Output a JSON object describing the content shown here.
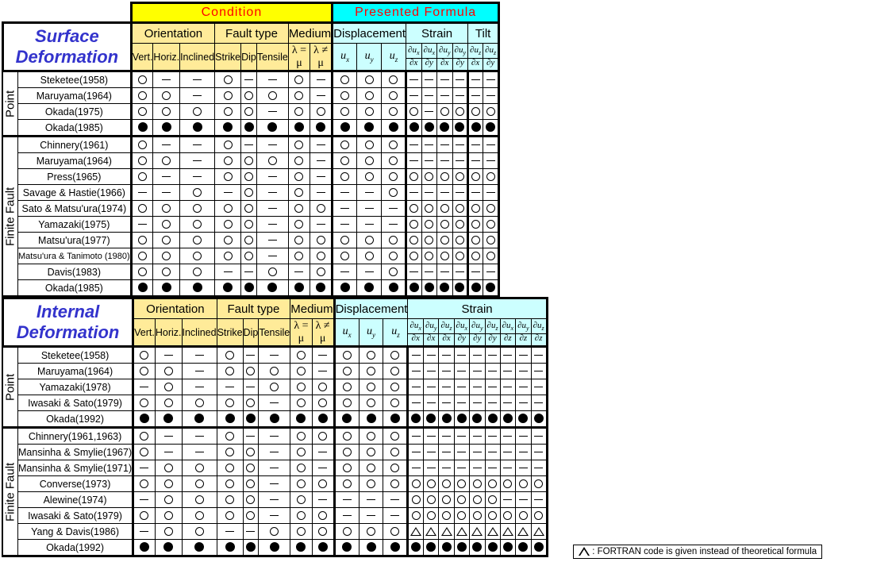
{
  "legend": {
    "triangle_note": ": FORTRAN code is given instead of theoretical formula",
    "symbols": {
      "open": "open-circle",
      "filled": "filled-circle",
      "dash": "dash",
      "triangle": "open-triangle"
    }
  },
  "colors": {
    "condition_band": "#ffff00",
    "presented_band": "#00ffff",
    "band_text": "#ff0000",
    "group_yellow": "#ffeb99",
    "group_cyan": "#ccffff",
    "title_green": "#ccf5cc",
    "title_text": "#3333cc"
  },
  "surface": {
    "title_line1": "Surface",
    "title_line2": "Deformation",
    "bands": {
      "condition": "Condition",
      "presented": "Presented Formula"
    },
    "groups": {
      "orientation": "Orientation",
      "fault_type": "Fault type",
      "medium": "Medium",
      "displacement": "Displacement",
      "strain": "Strain",
      "tilt": "Tilt"
    },
    "subheaders": {
      "orientation": [
        "Vert.",
        "Horiz.",
        "Inclined"
      ],
      "fault_type": [
        "Strike",
        "Dip",
        "Tensile"
      ],
      "medium": [
        "λ = μ",
        "λ ≠ μ"
      ],
      "displacement": [
        {
          "num": "u",
          "sub": "x"
        },
        {
          "num": "u",
          "sub": "y"
        },
        {
          "num": "u",
          "sub": "z"
        }
      ],
      "strain": [
        {
          "num": "∂u",
          "nsub": "x",
          "den": "∂x"
        },
        {
          "num": "∂u",
          "nsub": "x",
          "den": "∂y"
        },
        {
          "num": "∂u",
          "nsub": "y",
          "den": "∂x"
        },
        {
          "num": "∂u",
          "nsub": "y",
          "den": "∂y"
        }
      ],
      "tilt": [
        {
          "num": "∂u",
          "nsub": "z",
          "den": "∂x"
        },
        {
          "num": "∂u",
          "nsub": "z",
          "den": "∂y"
        }
      ]
    },
    "sections": [
      {
        "label": "Point",
        "rows": [
          {
            "name": "Steketee(1958)",
            "marks": [
              "o",
              "-",
              "-",
              "o",
              "-",
              "-",
              "o",
              "-",
              "o",
              "o",
              "o",
              "-",
              "-",
              "-",
              "-",
              "-",
              "-"
            ]
          },
          {
            "name": "Maruyama(1964)",
            "marks": [
              "o",
              "o",
              "-",
              "o",
              "o",
              "o",
              "o",
              "-",
              "o",
              "o",
              "o",
              "-",
              "-",
              "-",
              "-",
              "-",
              "-"
            ]
          },
          {
            "name": "Okada(1975)",
            "marks": [
              "o",
              "o",
              "o",
              "o",
              "o",
              "-",
              "o",
              "o",
              "o",
              "o",
              "o",
              "o",
              "-",
              "o",
              "o",
              "o",
              "o"
            ]
          },
          {
            "name": "Okada(1985)",
            "marks": [
              "f",
              "f",
              "f",
              "f",
              "f",
              "f",
              "f",
              "f",
              "f",
              "f",
              "f",
              "f",
              "f",
              "f",
              "f",
              "f",
              "f"
            ]
          }
        ]
      },
      {
        "label": "Finite Fault",
        "rows": [
          {
            "name": "Chinnery(1961)",
            "marks": [
              "o",
              "-",
              "-",
              "o",
              "-",
              "-",
              "o",
              "-",
              "o",
              "o",
              "o",
              "-",
              "-",
              "-",
              "-",
              "-",
              "-"
            ]
          },
          {
            "name": "Maruyama(1964)",
            "marks": [
              "o",
              "o",
              "-",
              "o",
              "o",
              "o",
              "o",
              "-",
              "o",
              "o",
              "o",
              "-",
              "-",
              "-",
              "-",
              "-",
              "-"
            ]
          },
          {
            "name": "Press(1965)",
            "marks": [
              "o",
              "-",
              "-",
              "o",
              "o",
              "-",
              "o",
              "-",
              "o",
              "o",
              "o",
              "o",
              "o",
              "o",
              "o",
              "o",
              "o"
            ]
          },
          {
            "name": "Savage & Hastie(1966)",
            "marks": [
              "-",
              "-",
              "o",
              "-",
              "o",
              "-",
              "o",
              "-",
              "-",
              "-",
              "o",
              "-",
              "-",
              "-",
              "-",
              "-",
              "-"
            ]
          },
          {
            "name": "Sato & Matsu'ura(1974)",
            "marks": [
              "o",
              "o",
              "o",
              "o",
              "o",
              "-",
              "o",
              "o",
              "-",
              "-",
              "-",
              "o",
              "o",
              "o",
              "o",
              "o",
              "o"
            ]
          },
          {
            "name": "Yamazaki(1975)",
            "marks": [
              "-",
              "o",
              "o",
              "o",
              "o",
              "-",
              "o",
              "-",
              "-",
              "-",
              "-",
              "o",
              "o",
              "o",
              "o",
              "o",
              "o"
            ]
          },
          {
            "name": "Matsu'ura(1977)",
            "marks": [
              "o",
              "o",
              "o",
              "o",
              "o",
              "-",
              "o",
              "o",
              "o",
              "o",
              "o",
              "o",
              "o",
              "o",
              "o",
              "o",
              "o"
            ]
          },
          {
            "name": "Matsu'ura & Tanimoto (1980)",
            "marks": [
              "o",
              "o",
              "o",
              "o",
              "o",
              "-",
              "o",
              "o",
              "o",
              "o",
              "o",
              "o",
              "o",
              "o",
              "o",
              "o",
              "o"
            ],
            "small": true
          },
          {
            "name": "Davis(1983)",
            "marks": [
              "o",
              "o",
              "o",
              "-",
              "-",
              "o",
              "-",
              "o",
              "-",
              "-",
              "o",
              "-",
              "-",
              "-",
              "-",
              "-",
              "-"
            ]
          },
          {
            "name": "Okada(1985)",
            "marks": [
              "f",
              "f",
              "f",
              "f",
              "f",
              "f",
              "f",
              "f",
              "f",
              "f",
              "f",
              "f",
              "f",
              "f",
              "f",
              "f",
              "f"
            ]
          }
        ]
      }
    ]
  },
  "internal": {
    "title_line1": "Internal",
    "title_line2": "Deformation",
    "groups": {
      "orientation": "Orientation",
      "fault_type": "Fault type",
      "medium": "Medium",
      "displacement": "Displacement",
      "strain": "Strain"
    },
    "subheaders": {
      "orientation": [
        "Vert.",
        "Horiz.",
        "Inclined"
      ],
      "fault_type": [
        "Strike",
        "Dip",
        "Tensile"
      ],
      "medium": [
        "λ = μ",
        "λ ≠ μ"
      ],
      "displacement": [
        {
          "num": "u",
          "sub": "x"
        },
        {
          "num": "u",
          "sub": "y"
        },
        {
          "num": "u",
          "sub": "z"
        }
      ],
      "strain": [
        {
          "num": "∂u",
          "nsub": "x",
          "den": "∂x"
        },
        {
          "num": "∂u",
          "nsub": "y",
          "den": "∂x"
        },
        {
          "num": "∂u",
          "nsub": "z",
          "den": "∂x"
        },
        {
          "num": "∂u",
          "nsub": "x",
          "den": "∂y"
        },
        {
          "num": "∂u",
          "nsub": "y",
          "den": "∂y"
        },
        {
          "num": "∂u",
          "nsub": "z",
          "den": "∂y"
        },
        {
          "num": "∂u",
          "nsub": "x",
          "den": "∂z"
        },
        {
          "num": "∂u",
          "nsub": "y",
          "den": "∂z"
        },
        {
          "num": "∂u",
          "nsub": "z",
          "den": "∂z"
        }
      ]
    },
    "sections": [
      {
        "label": "Point",
        "rows": [
          {
            "name": "Steketee(1958)",
            "marks": [
              "o",
              "-",
              "-",
              "o",
              "-",
              "-",
              "o",
              "-",
              "o",
              "o",
              "o",
              "-",
              "-",
              "-",
              "-",
              "-",
              "-",
              "-",
              "-",
              "-"
            ]
          },
          {
            "name": "Maruyama(1964)",
            "marks": [
              "o",
              "o",
              "-",
              "o",
              "o",
              "o",
              "o",
              "-",
              "o",
              "o",
              "o",
              "-",
              "-",
              "-",
              "-",
              "-",
              "-",
              "-",
              "-",
              "-"
            ]
          },
          {
            "name": "Yamazaki(1978)",
            "marks": [
              "-",
              "o",
              "-",
              "-",
              "-",
              "o",
              "o",
              "o",
              "o",
              "o",
              "o",
              "-",
              "-",
              "-",
              "-",
              "-",
              "-",
              "-",
              "-",
              "-"
            ]
          },
          {
            "name": "Iwasaki & Sato(1979)",
            "marks": [
              "o",
              "o",
              "o",
              "o",
              "o",
              "-",
              "o",
              "o",
              "o",
              "o",
              "o",
              "-",
              "-",
              "-",
              "-",
              "-",
              "-",
              "-",
              "-",
              "-"
            ]
          },
          {
            "name": "Okada(1992)",
            "marks": [
              "f",
              "f",
              "f",
              "f",
              "f",
              "f",
              "f",
              "f",
              "f",
              "f",
              "f",
              "f",
              "f",
              "f",
              "f",
              "f",
              "f",
              "f",
              "f",
              "f"
            ]
          }
        ]
      },
      {
        "label": "Finite Fault",
        "rows": [
          {
            "name": "Chinnery(1961,1963)",
            "marks": [
              "o",
              "-",
              "-",
              "o",
              "-",
              "-",
              "o",
              "o",
              "o",
              "o",
              "o",
              "-",
              "-",
              "-",
              "-",
              "-",
              "-",
              "-",
              "-",
              "-"
            ]
          },
          {
            "name": "Mansinha & Smylie(1967)",
            "marks": [
              "o",
              "-",
              "-",
              "o",
              "o",
              "-",
              "o",
              "-",
              "o",
              "o",
              "o",
              "-",
              "-",
              "-",
              "-",
              "-",
              "-",
              "-",
              "-",
              "-"
            ]
          },
          {
            "name": "Mansinha & Smylie(1971)",
            "marks": [
              "-",
              "o",
              "o",
              "o",
              "o",
              "-",
              "o",
              "-",
              "o",
              "o",
              "o",
              "-",
              "-",
              "-",
              "-",
              "-",
              "-",
              "-",
              "-",
              "-"
            ]
          },
          {
            "name": "Converse(1973)",
            "marks": [
              "o",
              "o",
              "o",
              "o",
              "o",
              "-",
              "o",
              "o",
              "o",
              "o",
              "o",
              "o",
              "o",
              "o",
              "o",
              "o",
              "o",
              "o",
              "o",
              "o"
            ]
          },
          {
            "name": "Alewine(1974)",
            "marks": [
              "-",
              "o",
              "o",
              "o",
              "o",
              "-",
              "o",
              "-",
              "-",
              "-",
              "-",
              "o",
              "o",
              "o",
              "o",
              "o",
              "o",
              "-",
              "-",
              "-"
            ]
          },
          {
            "name": "Iwasaki & Sato(1979)",
            "marks": [
              "o",
              "o",
              "o",
              "o",
              "o",
              "-",
              "o",
              "o",
              "-",
              "-",
              "-",
              "o",
              "o",
              "o",
              "o",
              "o",
              "o",
              "o",
              "o",
              "o"
            ]
          },
          {
            "name": "Yang & Davis(1986)",
            "marks": [
              "-",
              "o",
              "o",
              "-",
              "-",
              "o",
              "o",
              "o",
              "o",
              "o",
              "o",
              "t",
              "t",
              "t",
              "t",
              "t",
              "t",
              "t",
              "t",
              "t"
            ]
          },
          {
            "name": "Okada(1992)",
            "marks": [
              "f",
              "f",
              "f",
              "f",
              "f",
              "f",
              "f",
              "f",
              "f",
              "f",
              "f",
              "f",
              "f",
              "f",
              "f",
              "f",
              "f",
              "f",
              "f",
              "f"
            ]
          }
        ]
      }
    ]
  }
}
